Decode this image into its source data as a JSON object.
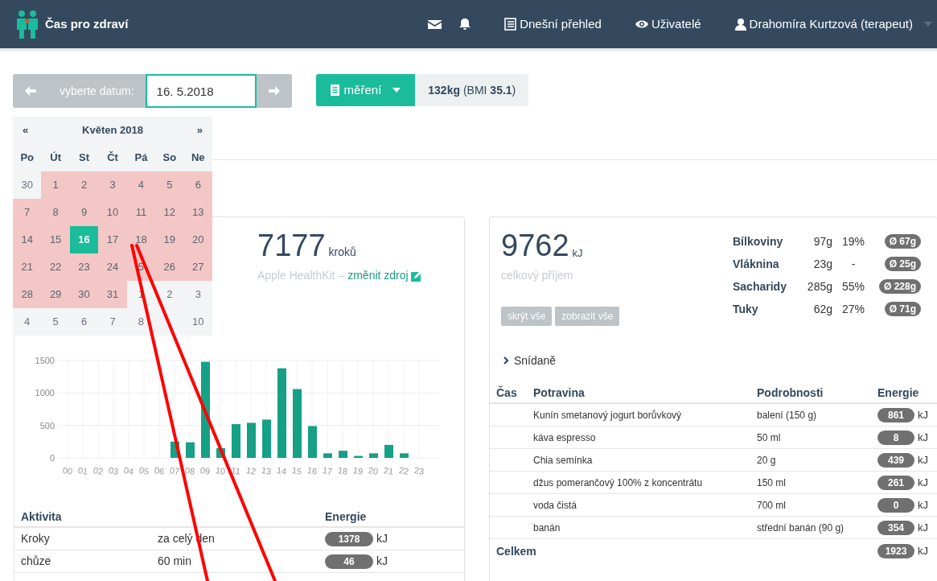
{
  "app": {
    "title": "Čas pro zdraví"
  },
  "nav": [
    {
      "kind": "mail"
    },
    {
      "kind": "bell"
    },
    {
      "kind": "list",
      "label": "Dnešní přehled"
    },
    {
      "kind": "eye",
      "label": "Uživatelé"
    },
    {
      "kind": "user",
      "label": "Drahomíra Kurtzová (terapeut)"
    }
  ],
  "date_picker": {
    "label": "vyberte datum:",
    "value": "16. 5.2018"
  },
  "measure_button": "měření",
  "weight": "**132kg** (BMI **35.1**)",
  "calendar": {
    "title": "Květen 2018",
    "prev": "«",
    "next": "»",
    "weekdays": [
      "Po",
      "Út",
      "St",
      "Čt",
      "Pá",
      "So",
      "Ne"
    ],
    "days": [
      {
        "label": "30",
        "in_range": false,
        "selected": false
      },
      {
        "label": "1",
        "in_range": true,
        "selected": false
      },
      {
        "label": "2",
        "in_range": true,
        "selected": false
      },
      {
        "label": "3",
        "in_range": true,
        "selected": false
      },
      {
        "label": "4",
        "in_range": true,
        "selected": false
      },
      {
        "label": "5",
        "in_range": true,
        "selected": false
      },
      {
        "label": "6",
        "in_range": true,
        "selected": false
      },
      {
        "label": "7",
        "in_range": true,
        "selected": false
      },
      {
        "label": "8",
        "in_range": true,
        "selected": false
      },
      {
        "label": "9",
        "in_range": true,
        "selected": false
      },
      {
        "label": "10",
        "in_range": true,
        "selected": false
      },
      {
        "label": "11",
        "in_range": true,
        "selected": false
      },
      {
        "label": "12",
        "in_range": true,
        "selected": false
      },
      {
        "label": "13",
        "in_range": true,
        "selected": false
      },
      {
        "label": "14",
        "in_range": true,
        "selected": false
      },
      {
        "label": "15",
        "in_range": true,
        "selected": false
      },
      {
        "label": "16",
        "in_range": true,
        "selected": true
      },
      {
        "label": "17",
        "in_range": true,
        "selected": false
      },
      {
        "label": "18",
        "in_range": true,
        "selected": false
      },
      {
        "label": "19",
        "in_range": true,
        "selected": false
      },
      {
        "label": "20",
        "in_range": true,
        "selected": false
      },
      {
        "label": "21",
        "in_range": true,
        "selected": false
      },
      {
        "label": "22",
        "in_range": true,
        "selected": false
      },
      {
        "label": "23",
        "in_range": true,
        "selected": false
      },
      {
        "label": "24",
        "in_range": true,
        "selected": false
      },
      {
        "label": "5",
        "in_range": true,
        "selected": false
      },
      {
        "label": "26",
        "in_range": true,
        "selected": false
      },
      {
        "label": "27",
        "in_range": true,
        "selected": false
      },
      {
        "label": "28",
        "in_range": true,
        "selected": false
      },
      {
        "label": "29",
        "in_range": true,
        "selected": false
      },
      {
        "label": "30",
        "in_range": true,
        "selected": false
      },
      {
        "label": "31",
        "in_range": true,
        "selected": false
      },
      {
        "label": "1",
        "in_range": false,
        "selected": false
      },
      {
        "label": "2",
        "in_range": false,
        "selected": false
      },
      {
        "label": "3",
        "in_range": false,
        "selected": false
      },
      {
        "label": "4",
        "in_range": false,
        "selected": false
      },
      {
        "label": "5",
        "in_range": false,
        "selected": false
      },
      {
        "label": "6",
        "in_range": false,
        "selected": false
      },
      {
        "label": "7",
        "in_range": false,
        "selected": false
      },
      {
        "label": "8",
        "in_range": false,
        "selected": false
      },
      {
        "covered": true
      },
      {
        "label": "10",
        "in_range": false,
        "selected": false
      }
    ]
  },
  "steps": {
    "value": "7177",
    "unit": "kroků",
    "source": "Apple HealthKit –",
    "link": "změnit zdroj",
    "chart_data": {
      "type": "bar",
      "categories": [
        "00",
        "01",
        "02",
        "03",
        "04",
        "05",
        "06",
        "07",
        "08",
        "09",
        "10",
        "11",
        "12",
        "13",
        "14",
        "15",
        "16",
        "17",
        "18",
        "19",
        "20",
        "21",
        "22",
        "23"
      ],
      "values": [
        0,
        0,
        0,
        0,
        0,
        0,
        0,
        250,
        240,
        1480,
        150,
        520,
        540,
        590,
        1380,
        1060,
        490,
        70,
        110,
        30,
        70,
        200,
        70,
        0
      ],
      "ylim": [
        0,
        1500
      ],
      "yticks": [
        0,
        500,
        1000,
        1500
      ],
      "grid": true
    }
  },
  "activity_table": {
    "columns": {
      "activity": "Aktivita",
      "energy": "Energie"
    },
    "rows": [
      {
        "activity": "Kroky",
        "detail": "za celý den",
        "energy": "1378",
        "unit": "kJ"
      },
      {
        "activity": "chůze",
        "detail": "60 min",
        "energy": "46",
        "unit": "kJ"
      }
    ]
  },
  "intake": {
    "value": "9762",
    "unit": "kJ",
    "label": "celkový příjem",
    "buttons": [
      "skrýt vše",
      "zobrazit vše"
    ],
    "nutrients": [
      {
        "name": "Bílkoviny",
        "amount": "97g",
        "share": "19%",
        "average": "Ø 67g"
      },
      {
        "name": "Vláknina",
        "amount": "23g",
        "share": "-",
        "average": "Ø 25g"
      },
      {
        "name": "Sacharidy",
        "amount": "285g",
        "share": "55%",
        "average": "Ø 228g"
      },
      {
        "name": "Tuky",
        "amount": "62g",
        "share": "27%",
        "average": "Ø 71g"
      }
    ],
    "meal": {
      "label": "Snídaně",
      "expanded": false
    }
  },
  "food_table": {
    "columns": [
      "Čas",
      "Potravina",
      "Podrobnosti",
      "Energie"
    ],
    "rows": [
      {
        "food": "Kunín smetanový jogurt borůvkový",
        "detail": "balení (150 g)",
        "energy": "861",
        "unit": "kJ"
      },
      {
        "food": "káva espresso",
        "detail": "50 ml",
        "energy": "8",
        "unit": "kJ"
      },
      {
        "food": "Chia semínka",
        "detail": "20 g",
        "energy": "439",
        "unit": "kJ"
      },
      {
        "food": "džus pomerančový 100% z koncentrátu",
        "detail": "150 ml",
        "energy": "261",
        "unit": "kJ"
      },
      {
        "food": "voda čistá",
        "detail": "700 ml",
        "energy": "0",
        "unit": "kJ"
      },
      {
        "food": "banán",
        "detail": "střední banán (90 g)",
        "energy": "354",
        "unit": "kJ"
      }
    ],
    "total": {
      "label": "Celkem",
      "energy": "1923",
      "unit": "kJ"
    }
  }
}
